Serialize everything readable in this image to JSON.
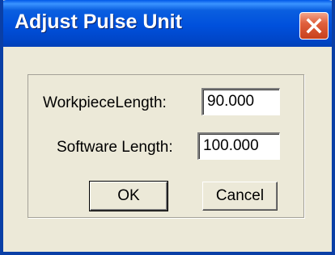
{
  "dialog": {
    "title": "Adjust Pulse Unit",
    "close_icon": "close-icon"
  },
  "fields": {
    "workpiece_length": {
      "label": "WorkpieceLength:",
      "value": "90.000"
    },
    "software_length": {
      "label": "Software Length:",
      "value": "100.000"
    }
  },
  "buttons": {
    "ok": "OK",
    "cancel": "Cancel"
  },
  "colors": {
    "titlebar": "#0050dc",
    "close": "#e0603d",
    "window_bg": "#ece9d8"
  }
}
